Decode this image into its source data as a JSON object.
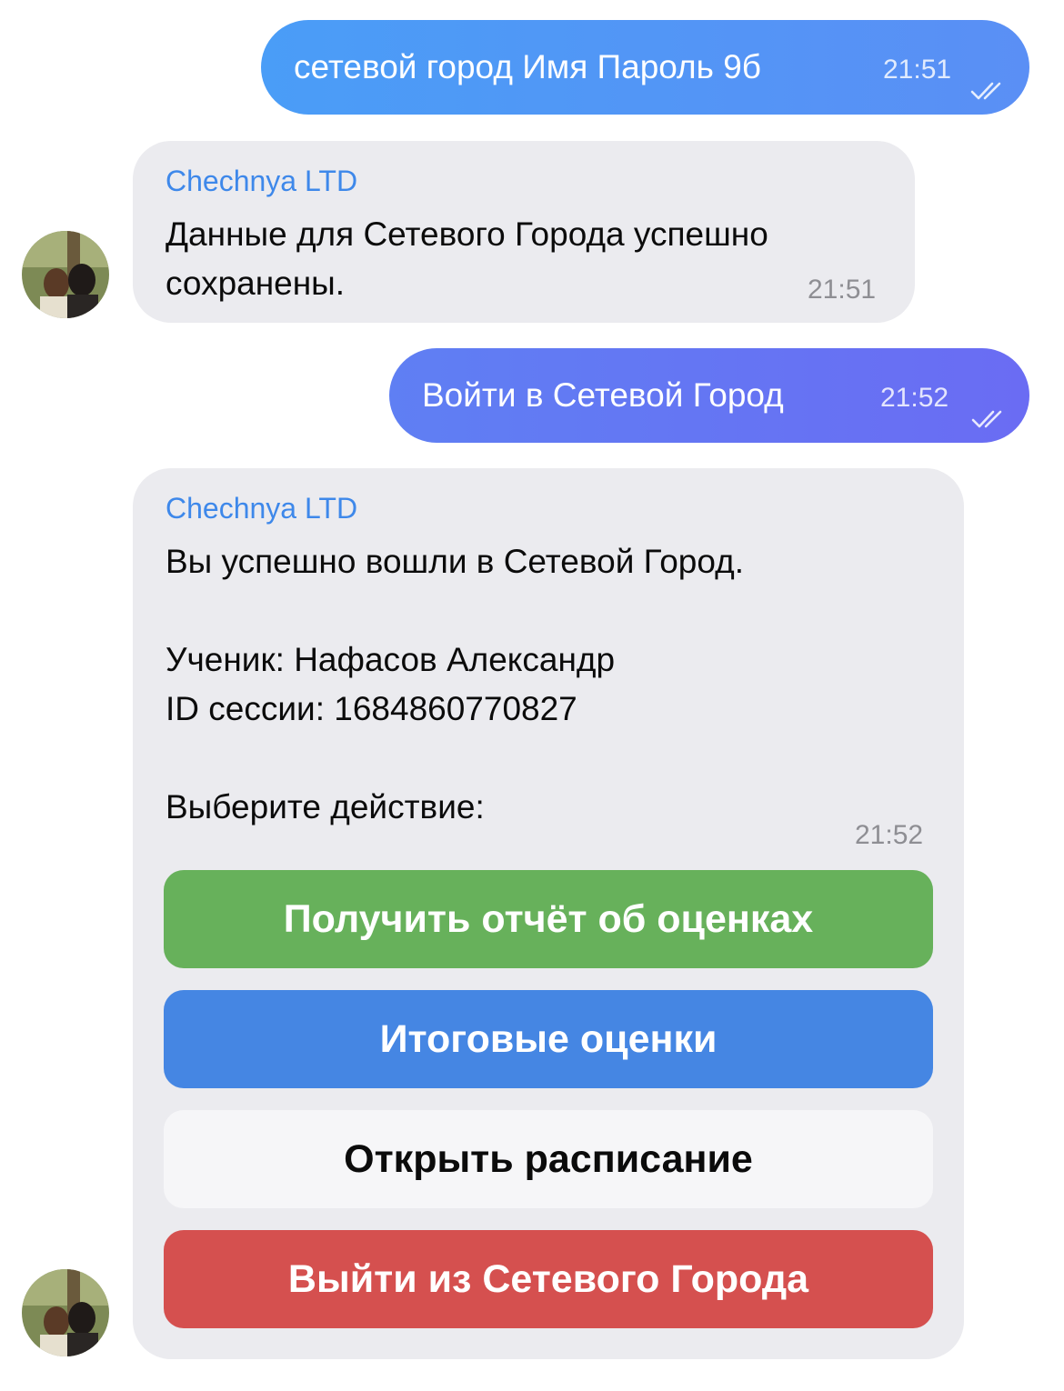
{
  "messages": [
    {
      "direction": "outgoing",
      "text": "сетевой город Имя Пароль 9б",
      "time": "21:51",
      "status_icon": "double-check-icon"
    },
    {
      "direction": "incoming",
      "sender": "Chechnya LTD",
      "text": "Данные для Сетевого Города успешно\nсохранены.",
      "time": "21:51"
    },
    {
      "direction": "outgoing",
      "text": "Войти в Сетевой Город",
      "time": "21:52",
      "status_icon": "double-check-icon"
    },
    {
      "direction": "incoming",
      "sender": "Chechnya LTD",
      "text": "Вы успешно вошли в Сетевой Город.\n\nУченик: Нафасов Александр\nID сессии: 1684860770827\n\nВыберите действие:",
      "time": "21:52",
      "keyboard": [
        {
          "label": "Получить отчёт об оценках",
          "color": "#67b15b",
          "text_color": "#ffffff"
        },
        {
          "label": "Итоговые оценки",
          "color": "#4586e3",
          "text_color": "#ffffff"
        },
        {
          "label": "Открыть расписание",
          "color": "#f6f6f8",
          "text_color": "#0b0b0b"
        },
        {
          "label": "Выйти из Сетевого Города",
          "color": "#d5504f",
          "text_color": "#ffffff"
        }
      ]
    }
  ],
  "colors": {
    "outgoing_gradient_1": [
      "#4a9df7",
      "#5a8ff5"
    ],
    "outgoing_gradient_2": [
      "#5f7ff3",
      "#6a6cf3"
    ],
    "incoming_bg": "#ebebef",
    "sender_name": "#3e88ea",
    "time_incoming": "#8e8e93"
  },
  "avatar": {
    "icon": "avatar-photo"
  }
}
